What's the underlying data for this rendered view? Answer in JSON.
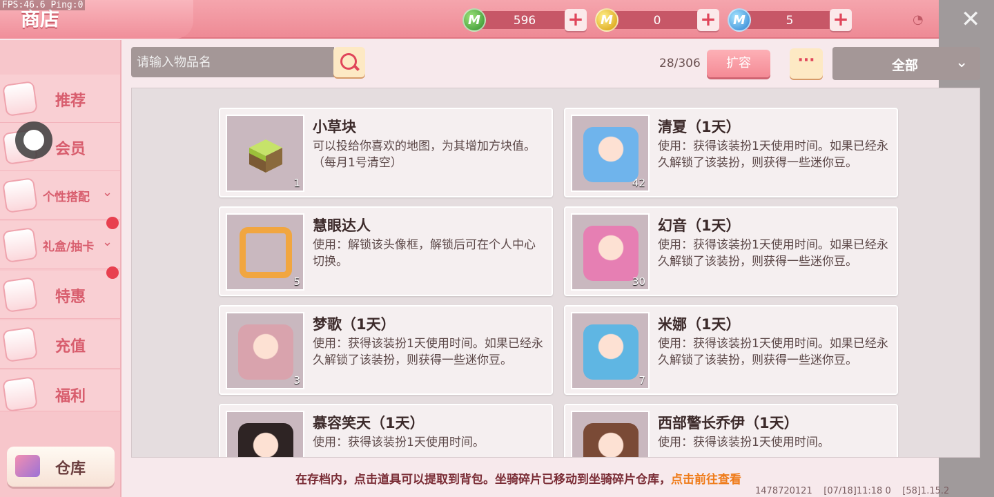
{
  "debug": "FPS:46.6  Ping:0",
  "header": {
    "title": "商店",
    "currencies": [
      {
        "icon": "green-mini-coin-icon",
        "letter": "M",
        "value": "596",
        "color": "#3aa338"
      },
      {
        "icon": "gold-mini-coin-icon",
        "letter": "M",
        "value": "0",
        "color": "#e7b414"
      },
      {
        "icon": "blue-mini-bean-icon",
        "letter": "M",
        "value": "5",
        "color": "#3b8fe0"
      }
    ],
    "plus_symbol": "+",
    "close_symbol": "✕"
  },
  "sidebar": {
    "items": [
      {
        "label": "推荐",
        "has_chevron": false,
        "badge": false
      },
      {
        "label": "会员",
        "has_chevron": false,
        "badge": false
      },
      {
        "label": "个性搭配",
        "has_chevron": true,
        "badge": false
      },
      {
        "label": "礼盒/抽卡",
        "has_chevron": true,
        "badge": true
      },
      {
        "label": "特惠",
        "has_chevron": false,
        "badge": true
      },
      {
        "label": "充值",
        "has_chevron": false,
        "badge": false
      },
      {
        "label": "福利",
        "has_chevron": false,
        "badge": false
      }
    ],
    "warehouse_label": "仓库",
    "chevron": "⌄"
  },
  "toolbar": {
    "search_placeholder": "请输入物品名",
    "count": "28/306",
    "expand_label": "扩容",
    "more_label": "···",
    "filter_value": "全部",
    "filter_chevron": "⌄"
  },
  "items": [
    {
      "name": "小草块",
      "desc": "可以投给你喜欢的地图，为其增加方块值。（每月1号清空）",
      "qty": "1",
      "art": "grass"
    },
    {
      "name": "清夏（1天）",
      "desc": "使用：获得该装扮1天使用时间。如果已经永久解锁了该装扮，则获得一些迷你豆。",
      "qty": "42",
      "art": "char",
      "color": "#6fb4ec"
    },
    {
      "name": "慧眼达人",
      "desc": "使用：解锁该头像框，解锁后可在个人中心切换。",
      "qty": "5",
      "art": "frame"
    },
    {
      "name": "幻音（1天）",
      "desc": "使用：获得该装扮1天使用时间。如果已经永久解锁了该装扮，则获得一些迷你豆。",
      "qty": "30",
      "art": "char",
      "color": "#e67fb3"
    },
    {
      "name": "梦歌（1天）",
      "desc": "使用：获得该装扮1天使用时间。如果已经永久解锁了该装扮，则获得一些迷你豆。",
      "qty": "3",
      "art": "char",
      "color": "#d9a3ad"
    },
    {
      "name": "米娜（1天）",
      "desc": "使用：获得该装扮1天使用时间。如果已经永久解锁了该装扮，则获得一些迷你豆。",
      "qty": "7",
      "art": "char",
      "color": "#5fb6e3"
    },
    {
      "name": "慕容笑天（1天）",
      "desc": "使用：获得该装扮1天使用时间。",
      "qty": "",
      "art": "char",
      "color": "#2e2424"
    },
    {
      "name": "西部警长乔伊（1天）",
      "desc": "使用：获得该装扮1天使用时间。",
      "qty": "",
      "art": "char",
      "color": "#7a4a36"
    }
  ],
  "footer": {
    "message": "在存档内，点击道具可以提取到背包。坐骑碎片已移动到坐骑碎片仓库，",
    "link": "点击前往查看",
    "uid": "1478720121",
    "time": "[07/18]11:18 0",
    "version": "[58]1.15.2"
  }
}
